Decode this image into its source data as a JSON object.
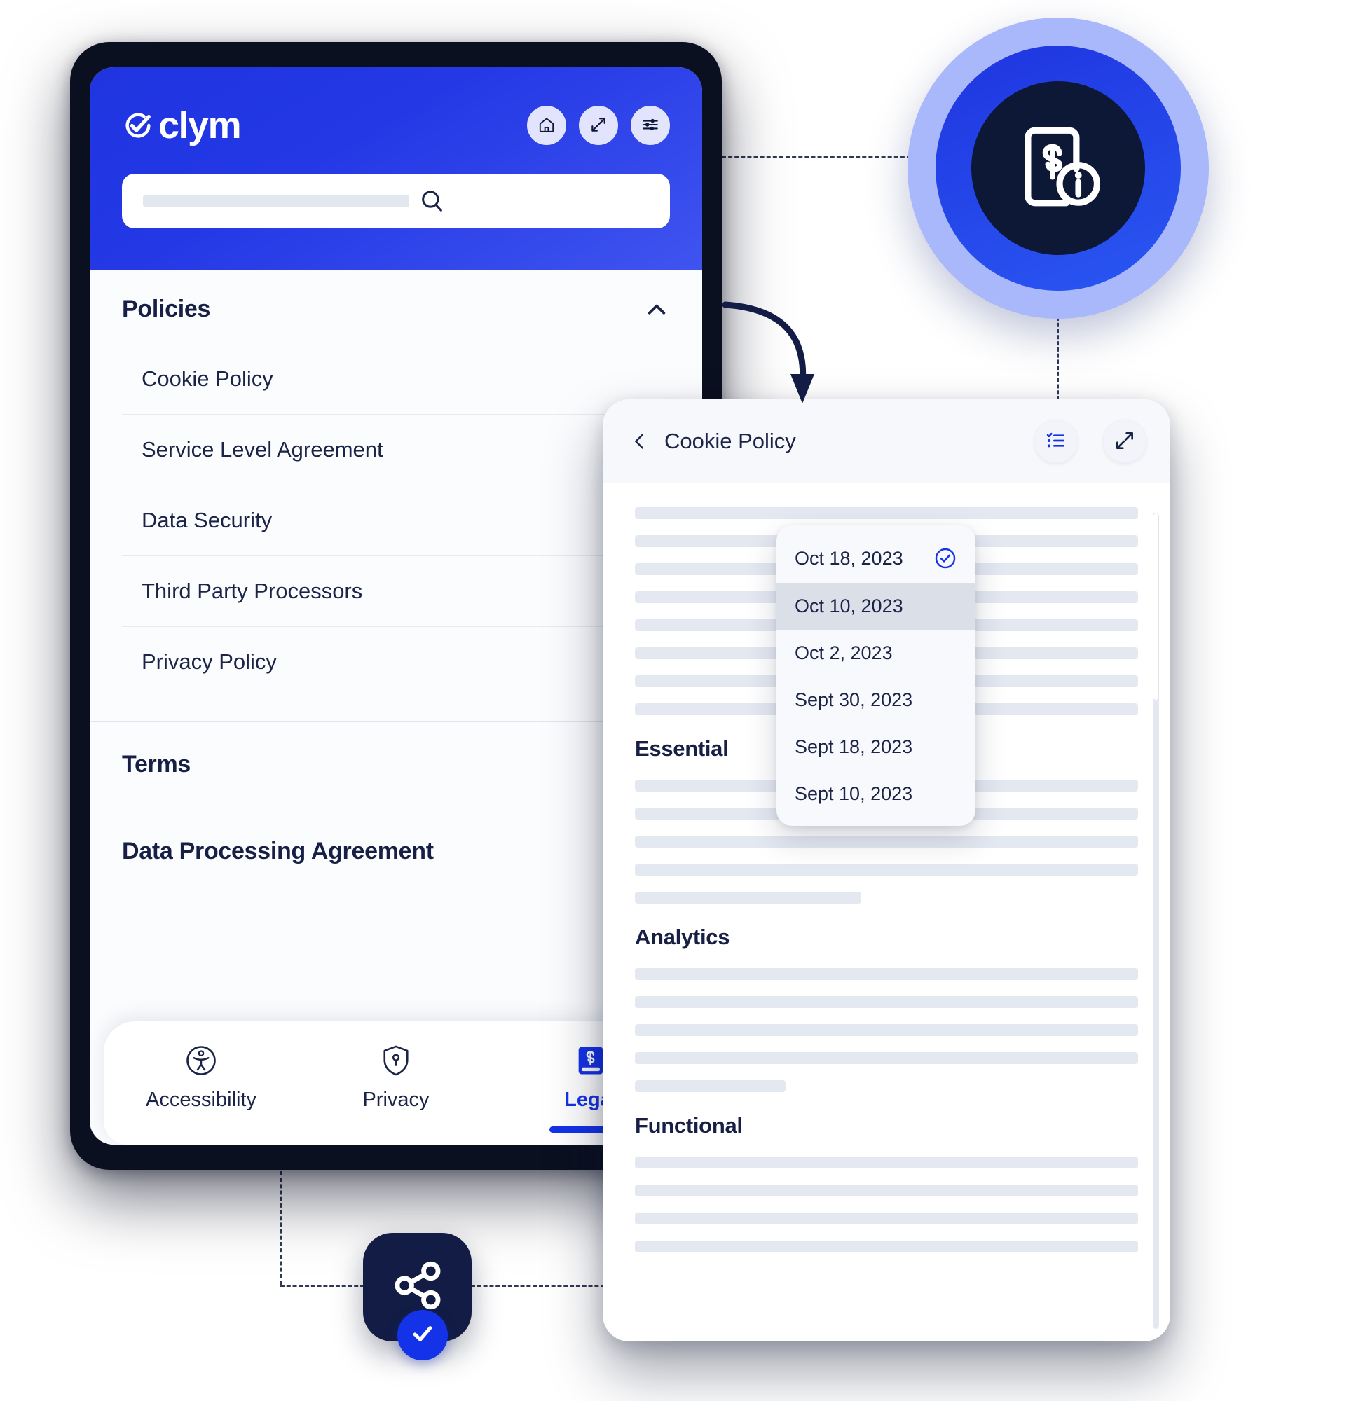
{
  "app": {
    "brand_name": "clym",
    "brand_icon": "clym-check-logo"
  },
  "phone": {
    "header": {
      "actions": [
        {
          "name": "home",
          "label": "Home",
          "icon": "home-icon"
        },
        {
          "name": "expand",
          "label": "Expand",
          "icon": "expand-diagonal-icon"
        },
        {
          "name": "preferences",
          "label": "Preferences",
          "icon": "sliders-icon"
        }
      ],
      "search": {
        "value": "",
        "placeholder": "",
        "icon": "search-icon"
      }
    },
    "sections": [
      {
        "title": "Policies",
        "expanded": true,
        "toggle_icon": "chevron-up-icon",
        "items": [
          "Cookie Policy",
          "Service Level Agreement",
          "Data Security",
          "Third Party Processors",
          "Privacy Policy"
        ]
      },
      {
        "title": "Terms",
        "expanded": false,
        "items": []
      },
      {
        "title": "Data Processing Agreement",
        "expanded": false,
        "items": []
      }
    ],
    "tabs": [
      {
        "label": "Accessibility",
        "icon": "accessibility-icon",
        "active": false
      },
      {
        "label": "Privacy",
        "icon": "shield-keyhole-icon",
        "active": false
      },
      {
        "label": "Legal",
        "icon": "legal-book-icon",
        "active": true
      }
    ]
  },
  "panel": {
    "back_icon": "chevron-left-icon",
    "title": "Cookie Policy",
    "actions": [
      {
        "name": "versions",
        "label": "Versions",
        "icon": "checklist-icon",
        "active": true
      },
      {
        "name": "expand",
        "label": "Expand",
        "icon": "expand-diagonal-icon",
        "active": false
      }
    ],
    "version_dropdown": {
      "options": [
        {
          "label": "Oct 18, 2023",
          "selected": true,
          "hovered": false
        },
        {
          "label": "Oct 10, 2023",
          "selected": false,
          "hovered": true
        },
        {
          "label": "Oct 2, 2023",
          "selected": false,
          "hovered": false
        },
        {
          "label": "Sept 30, 2023",
          "selected": false,
          "hovered": false
        },
        {
          "label": "Sept 18, 2023",
          "selected": false,
          "hovered": false
        },
        {
          "label": "Sept 10, 2023",
          "selected": false,
          "hovered": false
        }
      ],
      "check_icon": "check-circle-icon"
    },
    "content_sections": [
      {
        "heading": "",
        "lines": [
          100,
          100,
          100,
          100,
          100,
          100,
          100,
          100
        ]
      },
      {
        "heading": "Essential",
        "lines": [
          100,
          100,
          100,
          100,
          45
        ]
      },
      {
        "heading": "Analytics",
        "lines": [
          100,
          100,
          100,
          100,
          30
        ]
      },
      {
        "heading": "Functional",
        "lines": [
          100,
          100,
          100,
          100
        ]
      }
    ]
  },
  "badges": {
    "legal": {
      "icon": "legal-document-info-icon",
      "colors": {
        "outer": "#a9b7fb",
        "middle": "#2438e6",
        "core": "#0d1736"
      }
    },
    "share": {
      "icon": "share-nodes-icon",
      "check_icon": "check-icon",
      "colors": {
        "tile": "#121c44",
        "check": "#1433e8"
      }
    }
  },
  "theme": {
    "brand_blue": "#2438e6",
    "accent_blue": "#1433e8",
    "navy": "#171f45",
    "skeleton": "#e4e8f1",
    "panel_bg": "#ffffff"
  }
}
